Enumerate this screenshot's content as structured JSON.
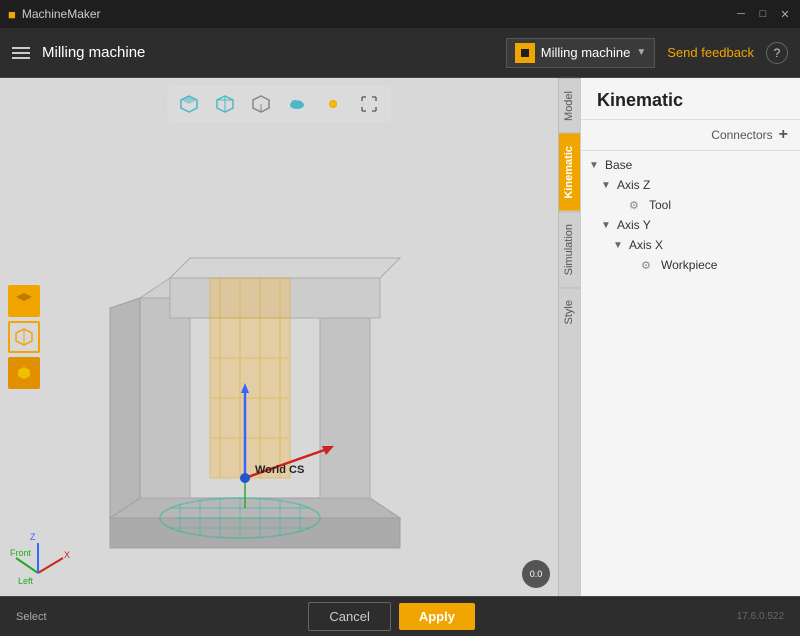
{
  "titlebar": {
    "app_name": "MachineMaker",
    "window_controls": [
      "minimize",
      "maximize",
      "close"
    ]
  },
  "toolbar": {
    "title": "Milling machine",
    "machine_selector": "Milling machine",
    "send_feedback": "Send feedback",
    "help": "?"
  },
  "tabs": [
    {
      "id": "model",
      "label": "Model",
      "active": false
    },
    {
      "id": "kinematic",
      "label": "Kinematic",
      "active": true
    },
    {
      "id": "simulation",
      "label": "Simulation",
      "active": false
    },
    {
      "id": "style",
      "label": "Style",
      "active": false
    }
  ],
  "panel": {
    "title": "Kinematic",
    "connectors_label": "Connectors",
    "add_label": "+",
    "tree": [
      {
        "level": 0,
        "toggle": "▼",
        "icon": "",
        "label": "Base"
      },
      {
        "level": 1,
        "toggle": "▼",
        "icon": "",
        "label": "Axis Z"
      },
      {
        "level": 2,
        "toggle": "",
        "icon": "⚙",
        "label": "Tool"
      },
      {
        "level": 1,
        "toggle": "▼",
        "icon": "",
        "label": "Axis Y"
      },
      {
        "level": 2,
        "toggle": "▼",
        "icon": "",
        "label": "Axis X"
      },
      {
        "level": 3,
        "toggle": "",
        "icon": "⚙",
        "label": "Workpiece"
      }
    ]
  },
  "viewport": {
    "world_cs_label": "World CS",
    "camera_label": "0.0"
  },
  "viewport_tools": [
    "cube-solid",
    "cube-outline",
    "cube-frame",
    "cloud",
    "sun",
    "expand"
  ],
  "left_tools": [
    "cube-yellow",
    "cube-outline-yellow",
    "cube-small-yellow"
  ],
  "bottom": {
    "status": "Select",
    "cancel_label": "Cancel",
    "apply_label": "Apply",
    "version": "17.6.0.522"
  }
}
